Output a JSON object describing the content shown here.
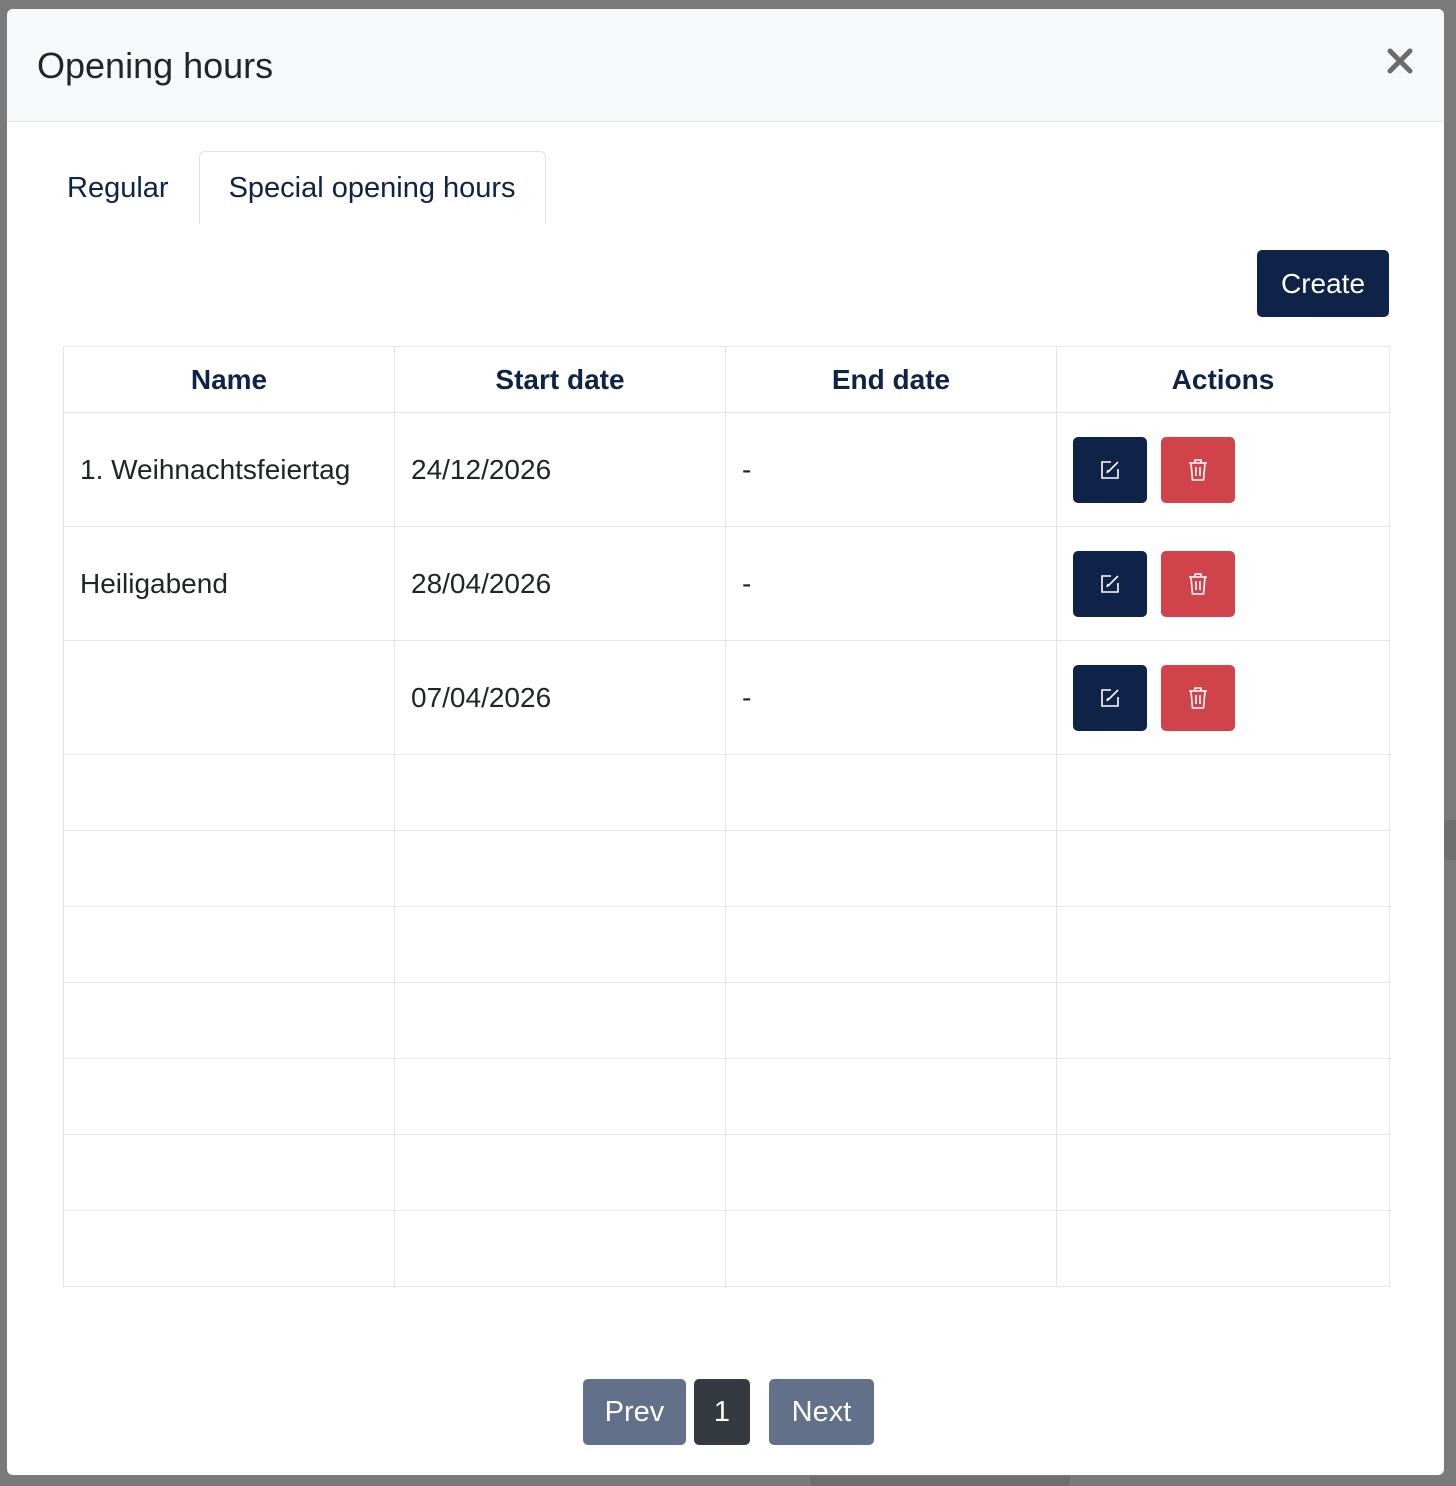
{
  "modal": {
    "title": "Opening hours",
    "close_icon": "close-icon"
  },
  "tabs": [
    {
      "label": "Regular",
      "active": false
    },
    {
      "label": "Special opening hours",
      "active": true
    }
  ],
  "toolbar": {
    "create_label": "Create"
  },
  "table": {
    "headers": [
      "Name",
      "Start date",
      "End date",
      "Actions"
    ],
    "rows": [
      {
        "name": "1. Weihnachtsfeiertag",
        "start_date": "24/12/2026",
        "end_date": "-"
      },
      {
        "name": "Heiligabend",
        "start_date": "28/04/2026",
        "end_date": "-"
      },
      {
        "name": "",
        "start_date": "07/04/2026",
        "end_date": "-"
      }
    ],
    "empty_rows": 7,
    "row_actions": {
      "edit_icon": "edit-icon",
      "delete_icon": "trash-icon"
    }
  },
  "pagination": {
    "prev_label": "Prev",
    "current_page": "1",
    "next_label": "Next"
  },
  "colors": {
    "primary": "#0e2347",
    "danger": "#d0434a",
    "pager": "#637089",
    "pager_active": "#343a40"
  }
}
